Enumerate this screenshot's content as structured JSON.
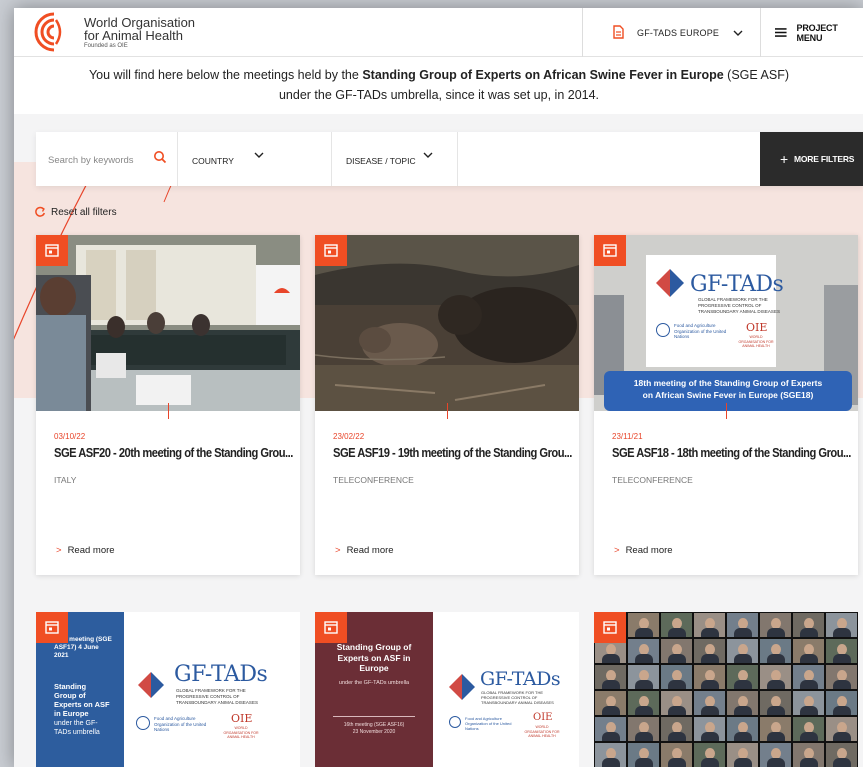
{
  "header": {
    "org_line1": "World Organisation",
    "org_line2": "for Animal Health",
    "org_line3": "Founded as OIE",
    "region_label": "GF-TADS EUROPE",
    "project_menu_label": "PROJECT MENU"
  },
  "intro": {
    "text_pre": "You will find here below the meetings held by the ",
    "text_bold": "Standing Group of Experts on African Swine Fever in Europe",
    "text_post": " (SGE ASF) under the GF-TADs umbrella, since it was set up, in 2014."
  },
  "filters": {
    "search_placeholder": "Search by keywords",
    "country_label": "COUNTRY",
    "disease_label": "DISEASE / TOPIC",
    "more_label": "MORE FILTERS",
    "reset_label": "Reset all filters"
  },
  "cards": [
    {
      "date": "03/10/22",
      "title": "SGE ASF20 - 20th meeting of the Standing Grou...",
      "place": "ITALY",
      "read_more": "Read more"
    },
    {
      "date": "23/02/22",
      "title": "SGE ASF19 - 19th meeting of the Standing Grou...",
      "place": "TELECONFERENCE",
      "read_more": "Read more"
    },
    {
      "date": "23/11/21",
      "title": "SGE ASF18 - 18th meeting of the Standing Grou...",
      "place": "TELECONFERENCE",
      "read_more": "Read more"
    }
  ],
  "card3_image": {
    "brand": "GF-TADs",
    "sub1": "GLOBAL FRAMEWORK FOR THE",
    "sub2": "PROGRESSIVE CONTROL OF",
    "sub3": "TRANSBOUNDARY ANIMAL DISEASES",
    "fao": "Food and Agriculture Organization of the United Nations",
    "oie": "OIE",
    "oie_sub": "WORLD ORGANISATION FOR ANIMAL HEALTH",
    "banner_line1": "18th meeting of the Standing Group of Experts",
    "banner_line2": "on African Swine Fever in Europe (SGE18)"
  },
  "card4_image": {
    "meeting": "17th meeting (SGE ASF17) 4 June 2021",
    "lines": [
      "Standing",
      "Group of",
      "Experts on ASF",
      "in Europe"
    ],
    "under": "under the GF-TADs umbrella",
    "brand": "GF-TADs",
    "sub1": "GLOBAL FRAMEWORK FOR THE",
    "sub2": "PROGRESSIVE CONTROL OF",
    "sub3": "TRANSBOUNDARY ANIMAL DISEASES",
    "fao": "Food and Agriculture Organization of the United Nations",
    "oie": "OIE",
    "oie_sub": "WORLD ORGANISATION FOR ANIMAL HEALTH"
  },
  "card5_image": {
    "title1": "Standing Group of",
    "title2": "Experts on ASF in",
    "title3": "Europe",
    "under": "under the GF-TADs umbrella",
    "meeting": "16th meeting (SGE ASF16)",
    "date": "23 November 2020",
    "brand": "GF-TADs",
    "sub1": "GLOBAL FRAMEWORK FOR THE",
    "sub2": "PROGRESSIVE CONTROL OF",
    "sub3": "TRANSBOUNDARY ANIMAL DISEASES",
    "fao": "Food and Agriculture Organization of the United Nations",
    "oie": "OIE",
    "oie_sub": "WORLD ORGANISATION FOR ANIMAL HEALTH"
  },
  "colors": {
    "accent": "#f04e23",
    "dark": "#2b2b2b",
    "band": "#f6e4df"
  }
}
